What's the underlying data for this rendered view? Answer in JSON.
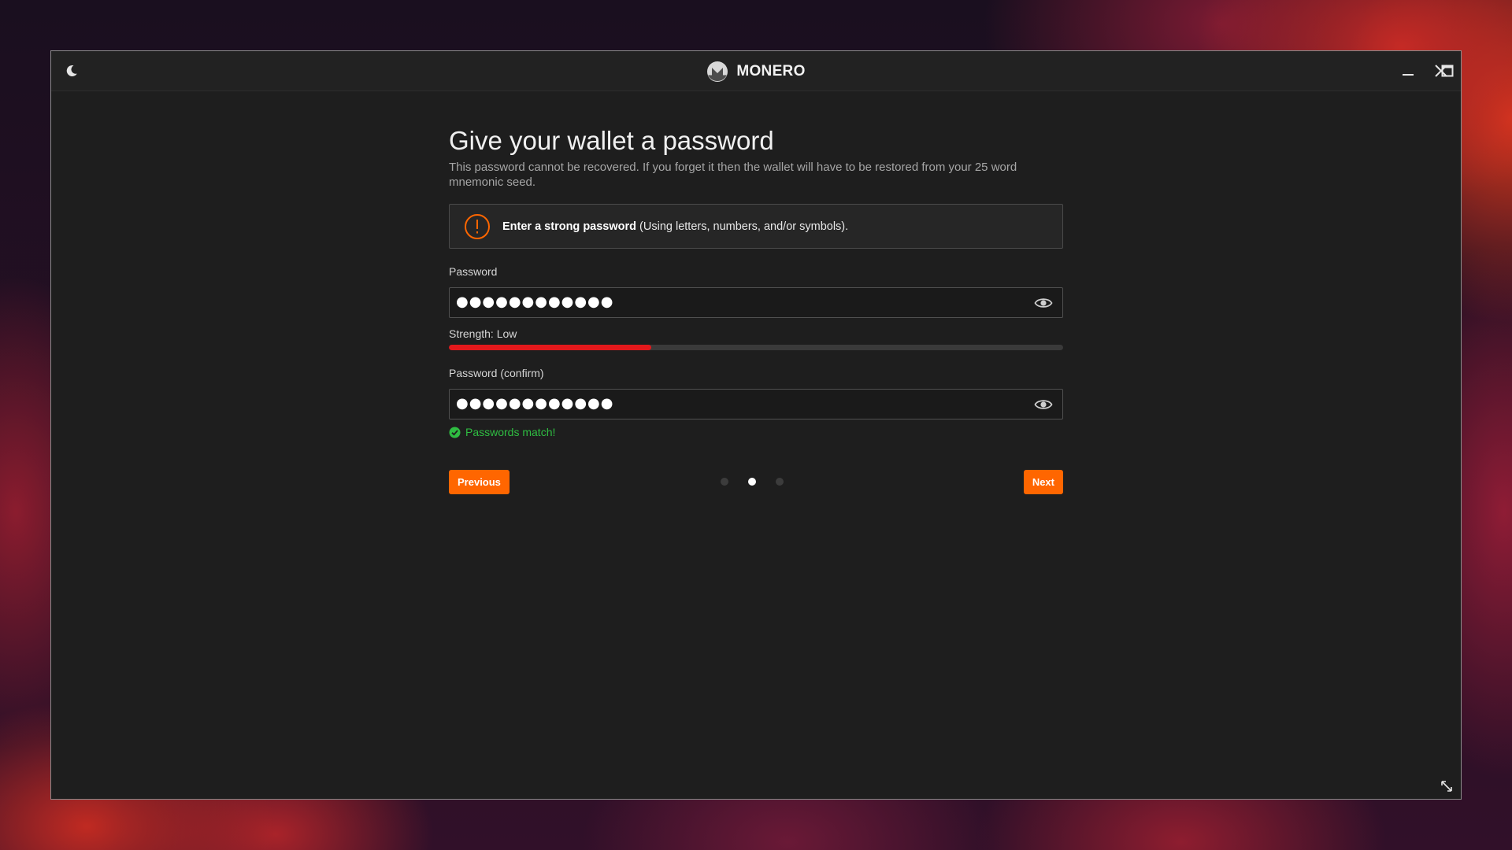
{
  "window": {
    "brand_name": "MONERO",
    "accent_color": "#ff6600"
  },
  "titlebar": {
    "theme_icon": "moon-icon",
    "minimize_icon": "minimize-icon",
    "maximize_icon": "maximize-icon",
    "close_icon": "close-icon"
  },
  "page": {
    "title": "Give your wallet a password",
    "subtitle": "This password cannot be recovered. If you forget it then the wallet will have to be restored from your 25 word mnemonic seed."
  },
  "warning": {
    "bold": "Enter a strong password",
    "rest": " (Using letters, numbers, and/or symbols).",
    "icon": "exclamation-circle-icon"
  },
  "password": {
    "label": "Password",
    "value": "●●●●●●●●●●●●",
    "strength_label": "Strength: Low",
    "strength_fraction": 0.33,
    "strength_color": "#e3181b"
  },
  "confirm": {
    "label": "Password (confirm)",
    "value": "●●●●●●●●●●●●",
    "match_text": "Passwords match!",
    "match_color": "#2fbd42"
  },
  "nav": {
    "previous_label": "Previous",
    "next_label": "Next",
    "steps_total": 3,
    "active_step": 2
  }
}
